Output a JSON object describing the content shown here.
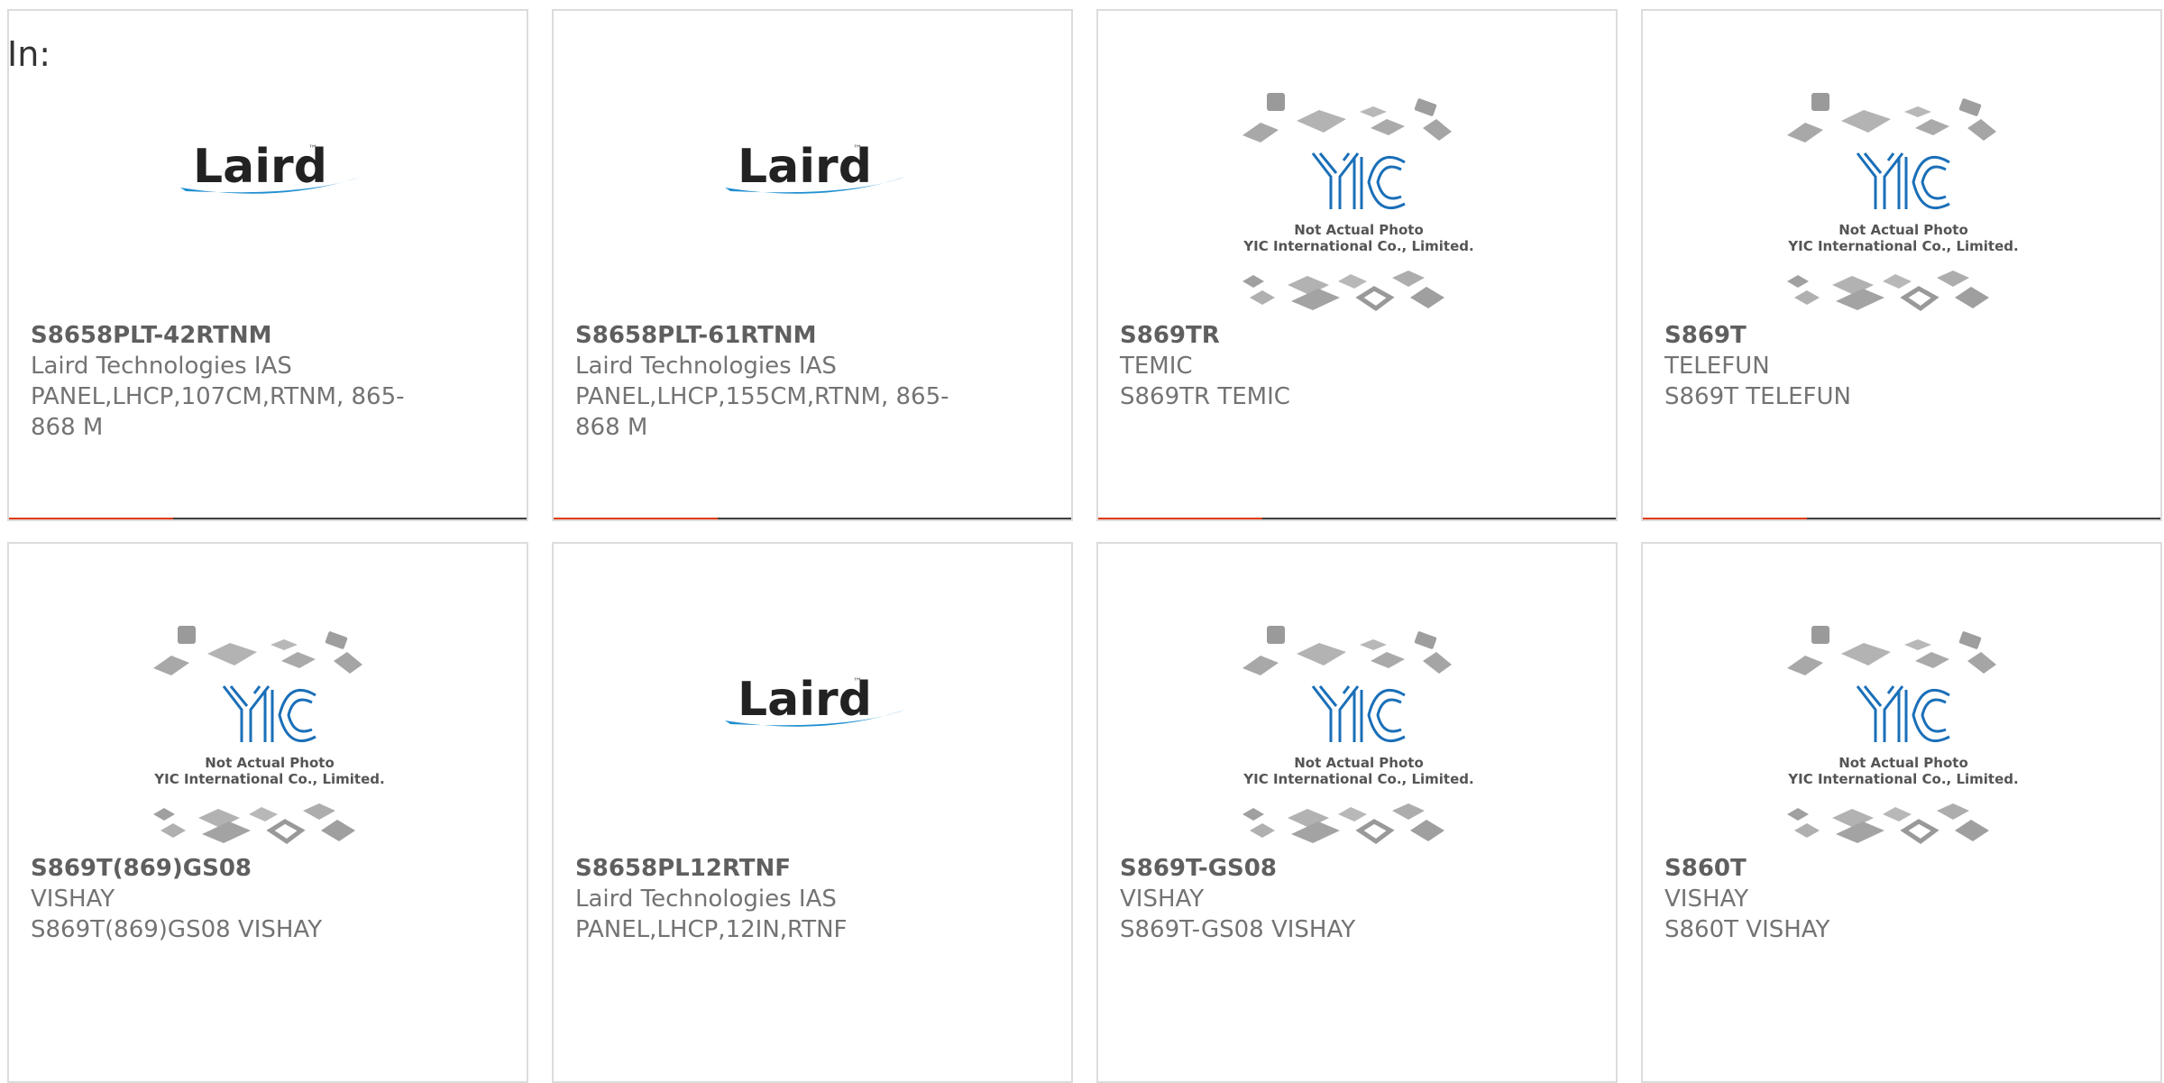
{
  "header": {
    "label": "In:"
  },
  "colors": {
    "accent": "#e03a0c",
    "bar": "#3e3e3e",
    "border": "#dcdcdc",
    "laird_blue": "#1f8fd0",
    "yic_blue": "#1a6fb8"
  },
  "placeholder_image": {
    "caption_line1": "Not Actual Photo",
    "caption_line2": "YIC International Co., Limited.",
    "logo_text": "YIC"
  },
  "laird_logo": {
    "text": "Laird"
  },
  "products": [
    {
      "part_number": "S8658PLT-42RTNM",
      "manufacturer": "Laird Technologies IAS",
      "description": "PANEL,LHCP,107CM,RTNM, 865-868 M",
      "image": "laird-logo"
    },
    {
      "part_number": "S8658PLT-61RTNM",
      "manufacturer": "Laird Technologies IAS",
      "description": "PANEL,LHCP,155CM,RTNM, 865-868 M",
      "image": "laird-logo"
    },
    {
      "part_number": "S869TR",
      "manufacturer": "TEMIC",
      "description": "S869TR TEMIC",
      "image": "not-actual-photo"
    },
    {
      "part_number": "S869T",
      "manufacturer": "TELEFUN",
      "description": "S869T TELEFUN",
      "image": "not-actual-photo"
    },
    {
      "part_number": "S869T(869)GS08",
      "manufacturer": "VISHAY",
      "description": "S869T(869)GS08 VISHAY",
      "image": "not-actual-photo"
    },
    {
      "part_number": "S8658PL12RTNF",
      "manufacturer": "Laird Technologies IAS",
      "description": "PANEL,LHCP,12IN,RTNF",
      "image": "laird-logo"
    },
    {
      "part_number": "S869T-GS08",
      "manufacturer": "VISHAY",
      "description": "S869T-GS08 VISHAY",
      "image": "not-actual-photo"
    },
    {
      "part_number": "S860T",
      "manufacturer": "VISHAY",
      "description": "S860T VISHAY",
      "image": "not-actual-photo"
    }
  ]
}
